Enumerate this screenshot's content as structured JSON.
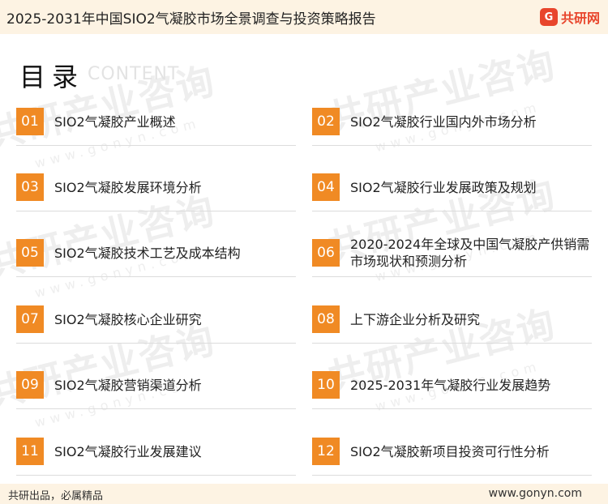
{
  "header": {
    "title": "2025-2031年中国SIO2气凝胶市场全景调查与投资策略报告",
    "brand_mark": "G",
    "brand_name": "共研网"
  },
  "toc": {
    "heading": "目录",
    "heading_en": "CONTENT",
    "items": [
      {
        "num": "01",
        "label": "SIO2气凝胶产业概述"
      },
      {
        "num": "02",
        "label": "SIO2气凝胶行业国内外市场分析"
      },
      {
        "num": "03",
        "label": "SIO2气凝胶发展环境分析"
      },
      {
        "num": "04",
        "label": "SIO2气凝胶行业发展政策及规划"
      },
      {
        "num": "05",
        "label": "SIO2气凝胶技术工艺及成本结构"
      },
      {
        "num": "06",
        "label": "2020-2024年全球及中国气凝胶产供销需市场现状和预测分析"
      },
      {
        "num": "07",
        "label": "SIO2气凝胶核心企业研究"
      },
      {
        "num": "08",
        "label": "上下游企业分析及研究"
      },
      {
        "num": "09",
        "label": "SIO2气凝胶营销渠道分析"
      },
      {
        "num": "10",
        "label": "2025-2031年气凝胶行业发展趋势"
      },
      {
        "num": "11",
        "label": "SIO2气凝胶行业发展建议"
      },
      {
        "num": "12",
        "label": "SIO2气凝胶新项目投资可行性分析"
      }
    ]
  },
  "watermark": {
    "text": "共研产业咨询",
    "sub": "www.gonyn.com"
  },
  "footer": {
    "slogan": "共研出品，必属精品",
    "url": "www.gonyn.com"
  },
  "colors": {
    "accent": "#f08a24",
    "brand": "#e8452c",
    "band": "#fdf3e3"
  }
}
